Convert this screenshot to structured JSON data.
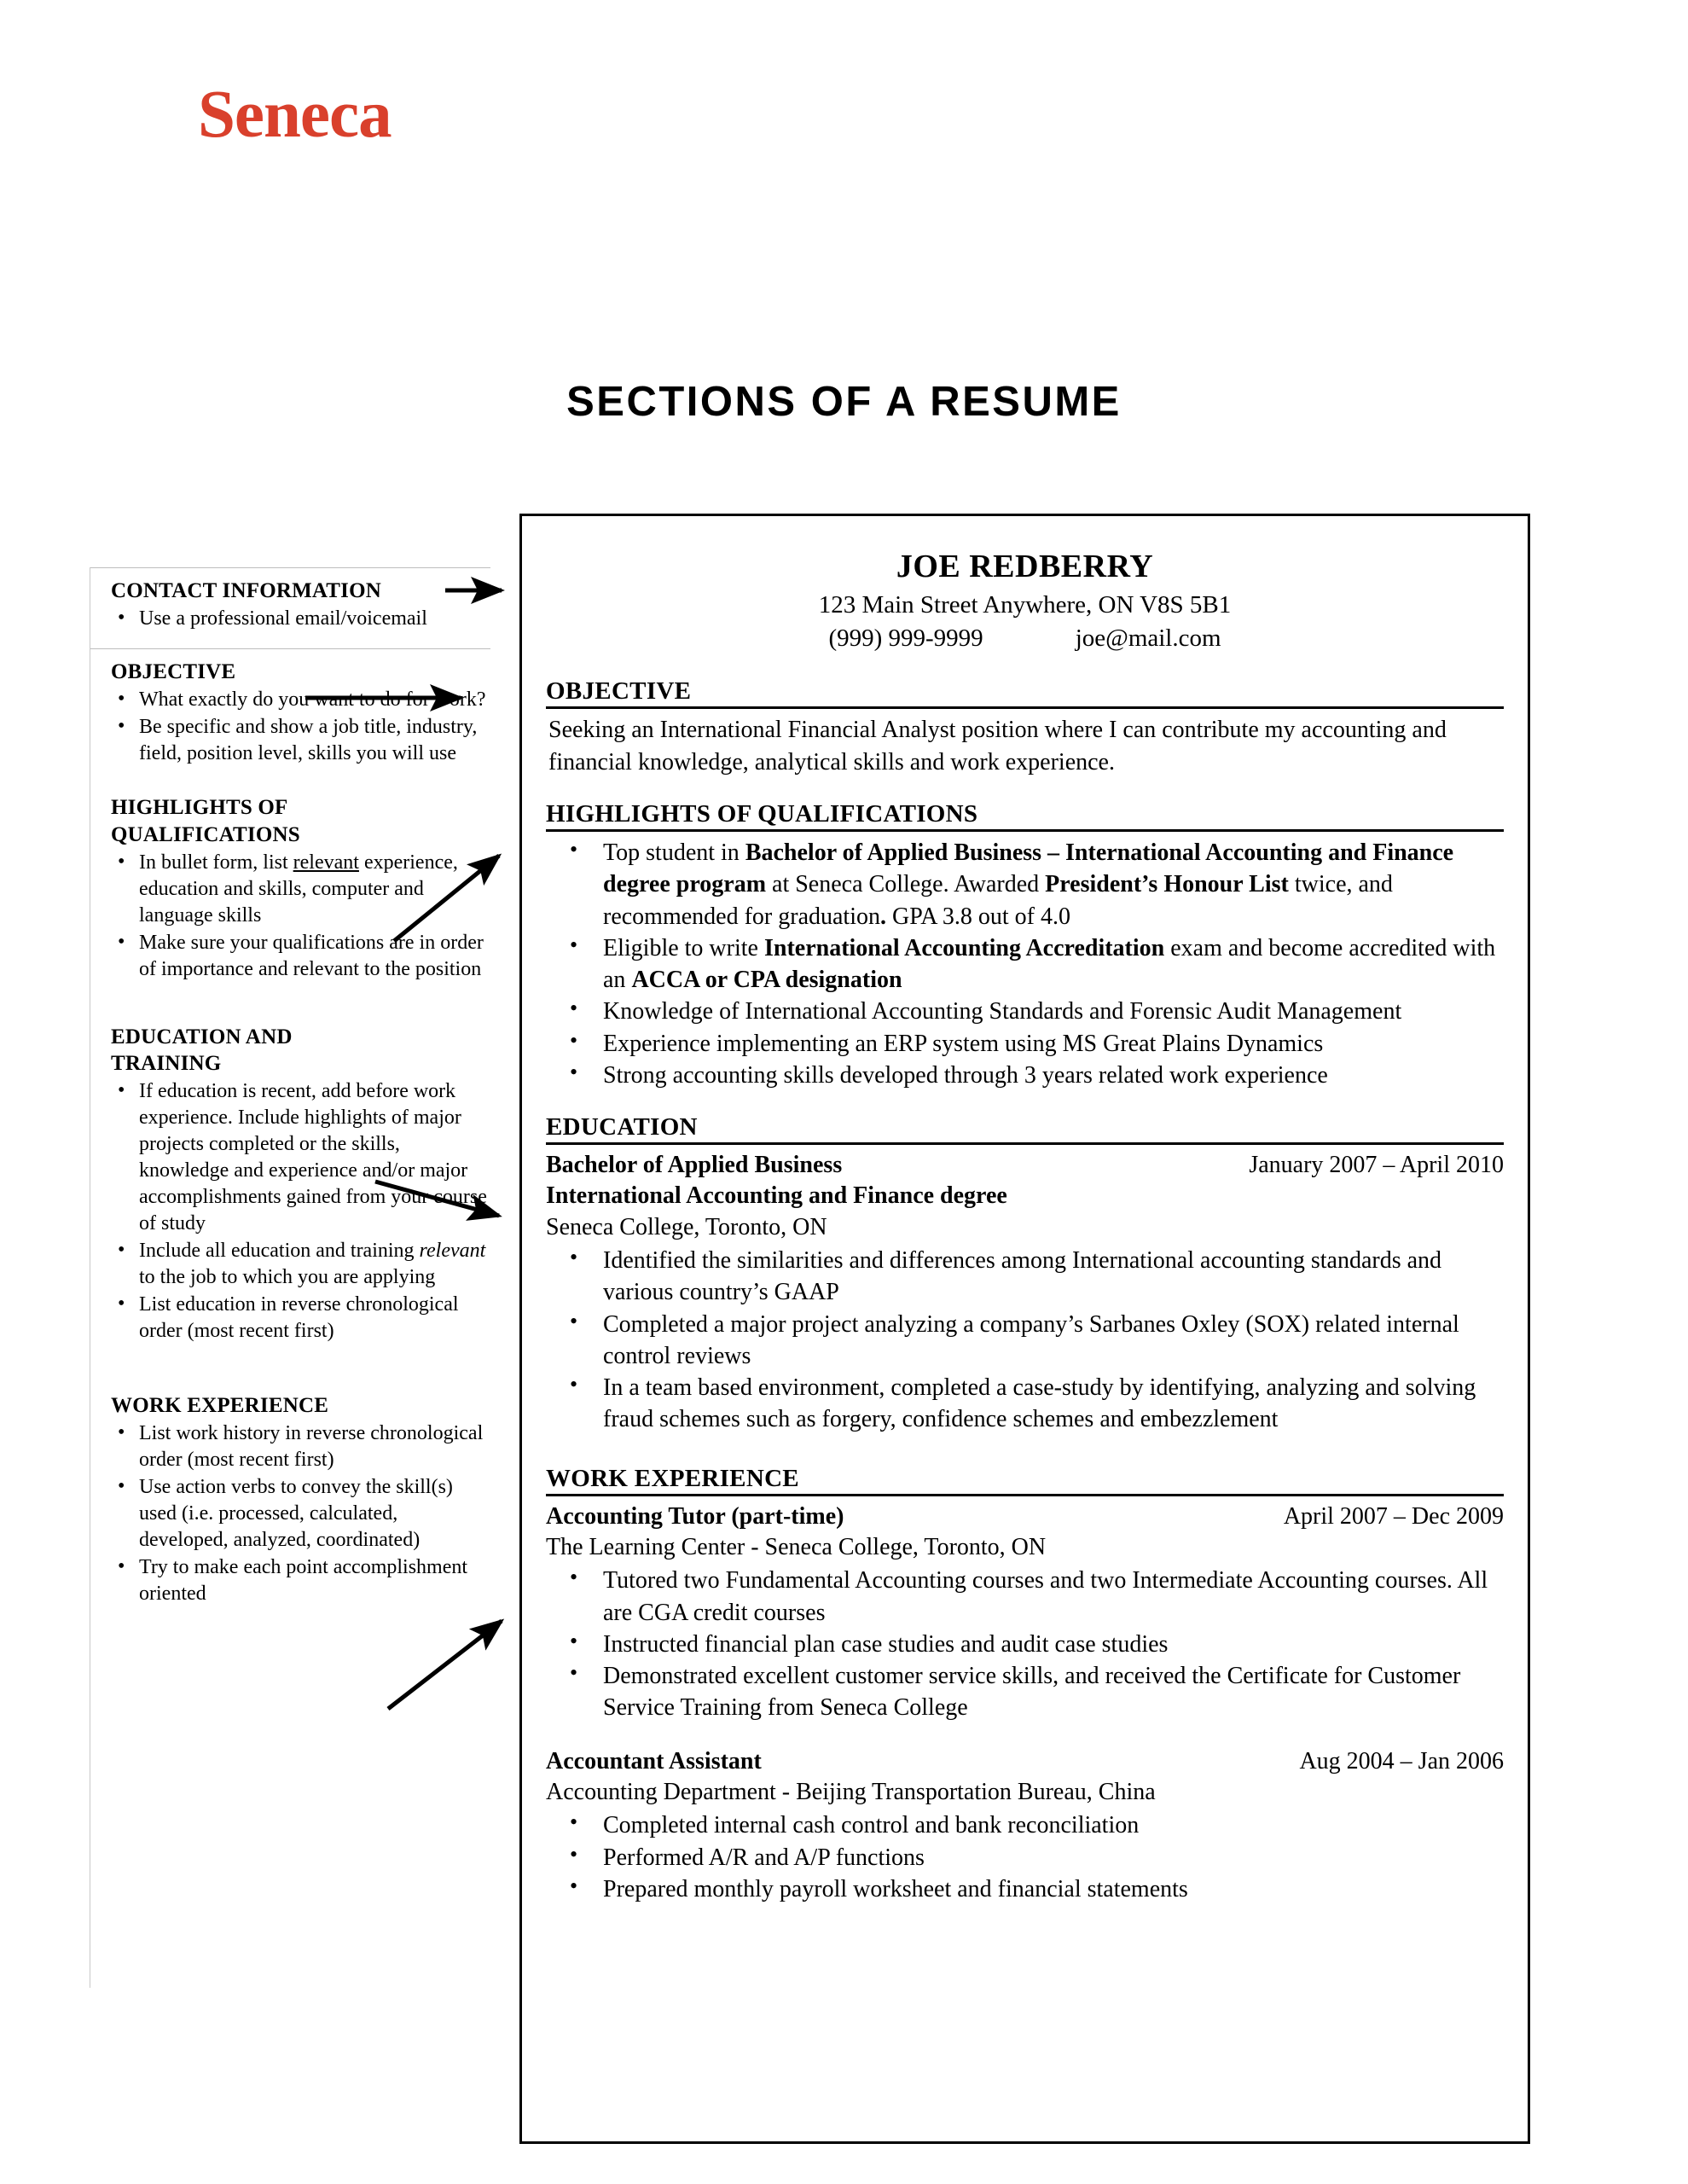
{
  "logo": {
    "text": "Seneca",
    "color": "#d9402c"
  },
  "page_title": "SECTIONS OF A RESUME",
  "annotations": [
    {
      "heading": "CONTACT INFORMATION",
      "bullets": [
        "Use a professional email/voicemail"
      ]
    },
    {
      "heading": "OBJECTIVE",
      "bullets": [
        "What exactly do you want to do for work?",
        "Be specific and show a job title, industry, field, position level, skills you will use"
      ]
    },
    {
      "heading": "HIGHLIGHTS OF QUALIFICATIONS",
      "bullets": [
        "In bullet form, list relevant experience, education and skills, computer and language skills",
        "Make sure your qualifications are in order of importance and relevant to the position"
      ]
    },
    {
      "heading": "EDUCATION AND TRAINING",
      "bullets": [
        "If education is recent, add before work experience. Include highlights of major projects completed or the skills, knowledge and experience  and/or major accomplishments gained from your course of study",
        "Include all education and training relevant to the job to which you are applying",
        "List education in reverse chronological order (most recent first)"
      ]
    },
    {
      "heading": "WORK EXPERIENCE",
      "bullets": [
        "List work history in reverse chronological order (most recent first)",
        "Use action verbs to convey the skill(s) used (i.e. processed, calculated, developed, analyzed, coordinated)",
        "Try to make each point accomplishment oriented"
      ]
    }
  ],
  "resume": {
    "name": "JOE REDBERRY",
    "address": "123 Main Street Anywhere, ON V8S 5B1",
    "phone": "(999) 999-9999",
    "email": "joe@mail.com",
    "objective": {
      "heading": "OBJECTIVE",
      "text": "Seeking an International Financial Analyst position where I can contribute my accounting and financial knowledge, analytical skills and work experience."
    },
    "highlights": {
      "heading": "HIGHLIGHTS OF QUALIFICATIONS",
      "bullets": [
        "Top student in <b>Bachelor of Applied Business – International Accounting and Finance degree program</b> at Seneca College. Awarded <b>President’s Honour List</b> twice, and recommended for graduation<b>.</b> GPA 3.8 out of 4.0",
        "Eligible to write <b>International Accounting Accreditation</b> exam and become accredited with an <b>ACCA or CPA designation</b>",
        "Knowledge of International Accounting Standards and Forensic Audit Management",
        "Experience implementing an ERP system using MS Great Plains Dynamics",
        "Strong accounting skills developed through 3 years related work experience"
      ]
    },
    "education": {
      "heading": "EDUCATION",
      "degree": "Bachelor of Applied Business",
      "dates": "January 2007 – April 2010",
      "program": "International Accounting and Finance degree",
      "school": "Seneca College, Toronto, ON",
      "bullets": [
        "Identified the similarities and differences among International accounting standards and various country’s GAAP",
        "Completed a major project analyzing a company’s Sarbanes Oxley (SOX) related internal control reviews",
        "In a team based environment, completed a case-study by identifying, analyzing and solving fraud schemes such as forgery, confidence schemes and embezzlement"
      ]
    },
    "work_experience": {
      "heading": "WORK EXPERIENCE",
      "jobs": [
        {
          "title": "Accounting Tutor (part-time)",
          "dates": "April 2007 – Dec 2009",
          "employer": "The Learning Center - Seneca College, Toronto, ON",
          "bullets": [
            "Tutored two Fundamental Accounting courses and two Intermediate Accounting courses. All are CGA credit courses",
            "Instructed financial plan case studies and audit case studies",
            "Demonstrated excellent customer service skills, and received the Certificate for Customer Service Training from Seneca College"
          ]
        },
        {
          "title": "Accountant Assistant",
          "dates": "Aug 2004 – Jan 2006",
          "employer": "Accounting Department - Beijing Transportation Bureau, China",
          "bullets": [
            "Completed internal cash control and bank reconciliation",
            "Performed A/R and A/P functions",
            "Prepared monthly payroll worksheet and financial statements"
          ]
        }
      ]
    }
  }
}
